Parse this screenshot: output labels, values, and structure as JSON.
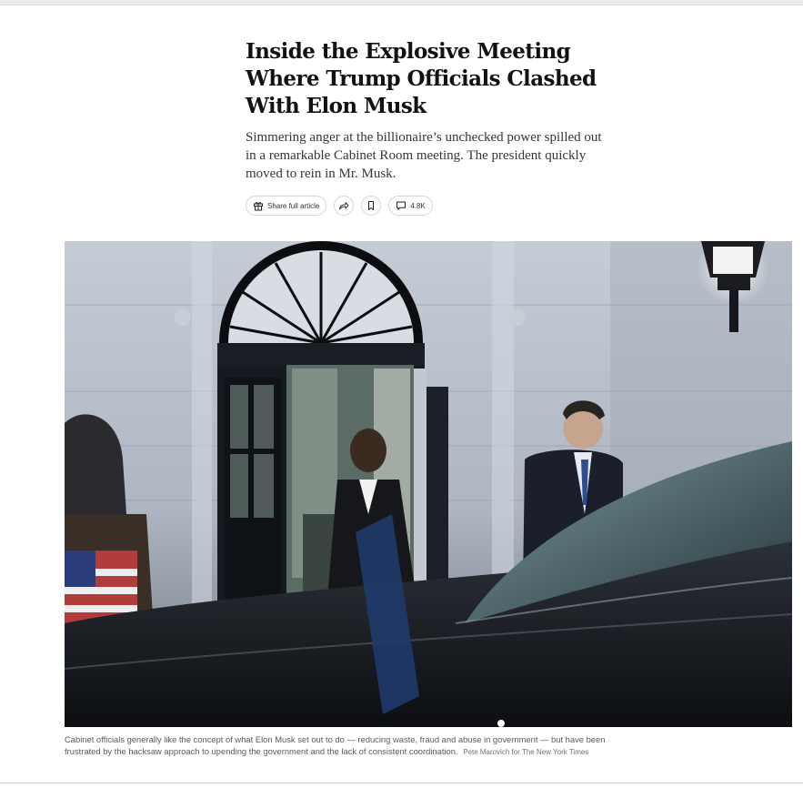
{
  "article": {
    "headline": "Inside the Explosive Meeting Where Trump Officials Clashed With Elon Musk",
    "summary": "Simmering anger at the billionaire’s unchecked power spilled out in a remarkable Cabinet Room meeting. The president quickly moved to rein in Mr. Musk."
  },
  "toolbar": {
    "share_label": "Share full article",
    "comments_count": "4.8K",
    "icons": [
      "gift-icon",
      "share-arrow-icon",
      "bookmark-icon",
      "comment-icon"
    ]
  },
  "photo": {
    "caption": "Cabinet officials generally like the concept of what Elon Musk set out to do — reducing waste, fraud and abuse in government — but have been frustrated by the hacksaw approach to upending the government and the lack of consistent coordination.",
    "credit": "Pete Marovich for The New York Times"
  }
}
